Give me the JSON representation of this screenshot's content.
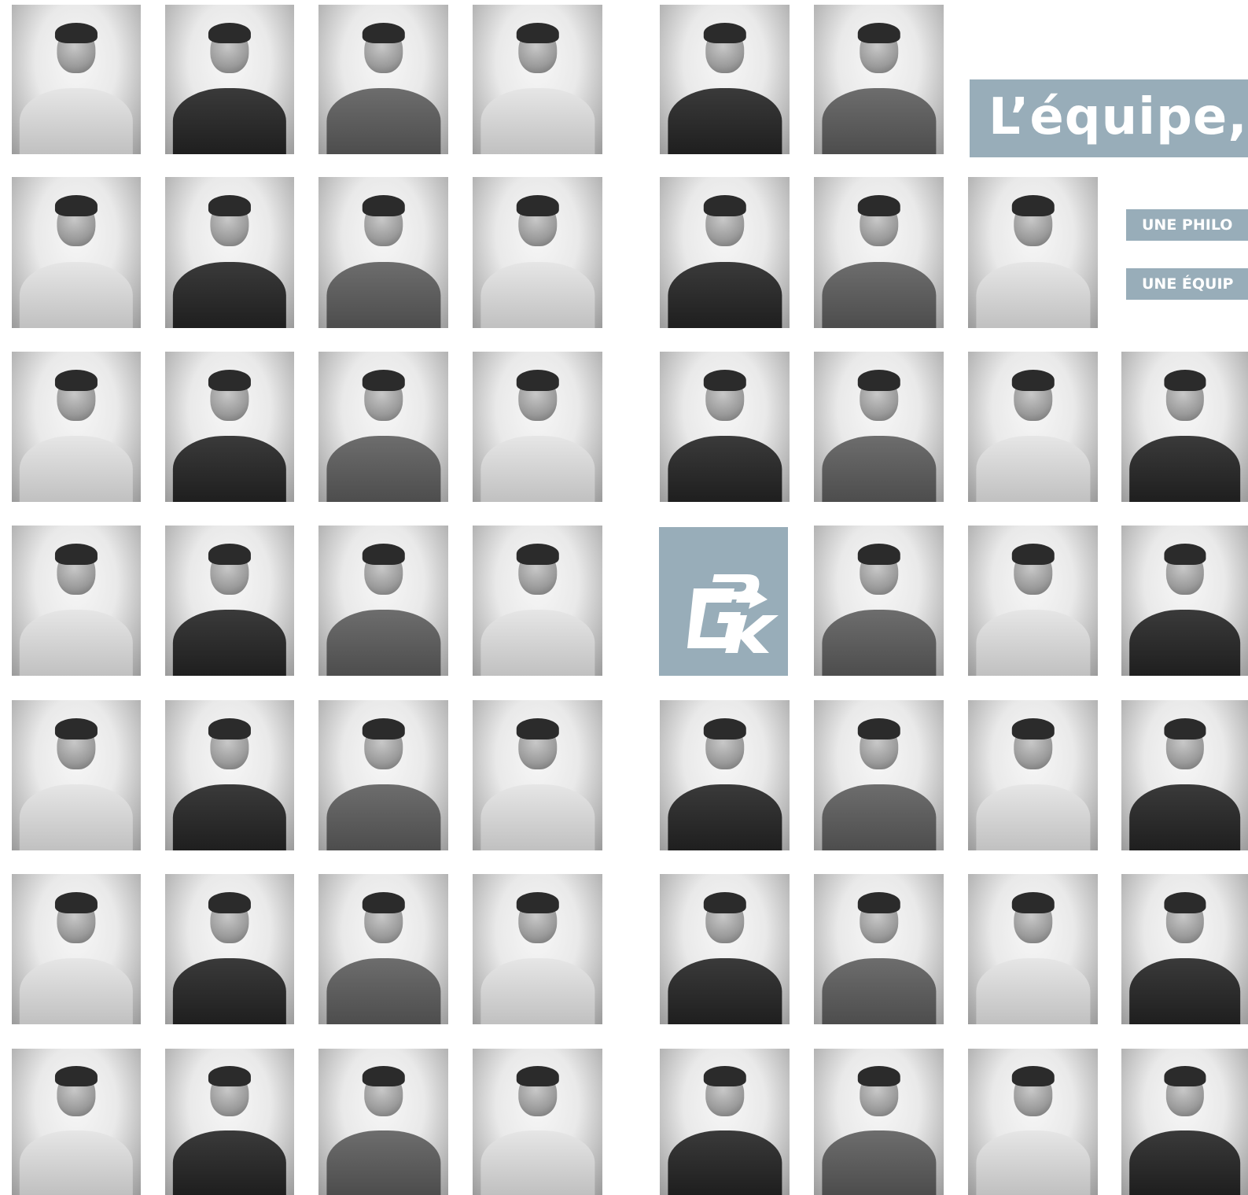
{
  "heading": "L’équipe,",
  "taglines": [
    "UNE PHILO",
    "UNE ÉQUIP"
  ],
  "logo_text": "GPK",
  "photo_count": 52,
  "colors": {
    "accent": "#98adb9",
    "background": "#ffffff",
    "text_on_accent": "#ffffff"
  }
}
